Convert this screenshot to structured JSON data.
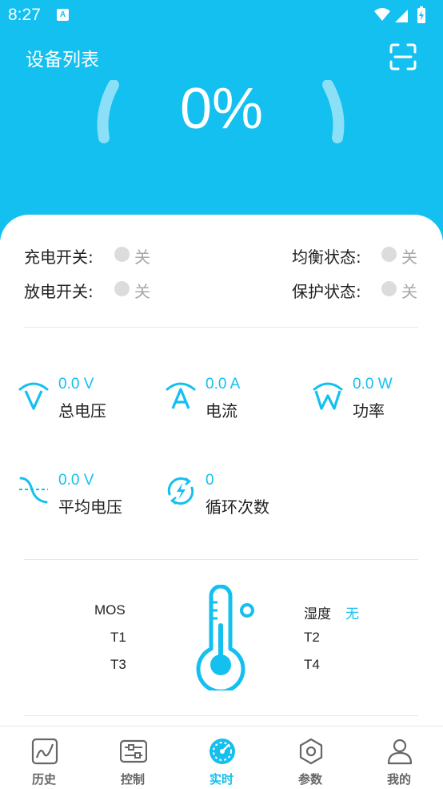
{
  "status_bar": {
    "time": "8:27",
    "notification_glyph": "A"
  },
  "header": {
    "title": "设备列表",
    "scan_icon": "scan-icon"
  },
  "battery": {
    "soc_text": "0%"
  },
  "switches": {
    "charge": {
      "label": "充电开关:",
      "value": "关"
    },
    "discharge": {
      "label": "放电开关:",
      "value": "关"
    },
    "balance": {
      "label": "均衡状态:",
      "value": "关"
    },
    "protect": {
      "label": "保护状态:",
      "value": "关"
    }
  },
  "metrics": {
    "total_voltage": {
      "value": "0.0 V",
      "label": "总电压",
      "icon": "voltage-icon"
    },
    "current": {
      "value": "0.0 A",
      "label": "电流",
      "icon": "current-icon"
    },
    "power": {
      "value": "0.0 W",
      "label": "功率",
      "icon": "power-icon"
    },
    "avg_voltage": {
      "value": "0.0 V",
      "label": "平均电压",
      "icon": "avg-voltage-icon"
    },
    "cycles": {
      "value": "0",
      "label": "循环次数",
      "icon": "cycle-icon"
    }
  },
  "temperature": {
    "mos": "MOS",
    "t1": "T1",
    "t3": "T3",
    "humidity_label": "湿度",
    "humidity_value": "无",
    "t2": "T2",
    "t4": "T4"
  },
  "nav": [
    {
      "label": "历史",
      "icon": "history-chart-icon"
    },
    {
      "label": "控制",
      "icon": "control-sliders-icon"
    },
    {
      "label": "实时",
      "icon": "realtime-gauge-icon",
      "active": true
    },
    {
      "label": "参数",
      "icon": "parameters-hexagon-icon"
    },
    {
      "label": "我的",
      "icon": "profile-icon"
    }
  ],
  "colors": {
    "accent": "#13c0ef",
    "text": "#222222",
    "muted": "#a8a8a8"
  }
}
